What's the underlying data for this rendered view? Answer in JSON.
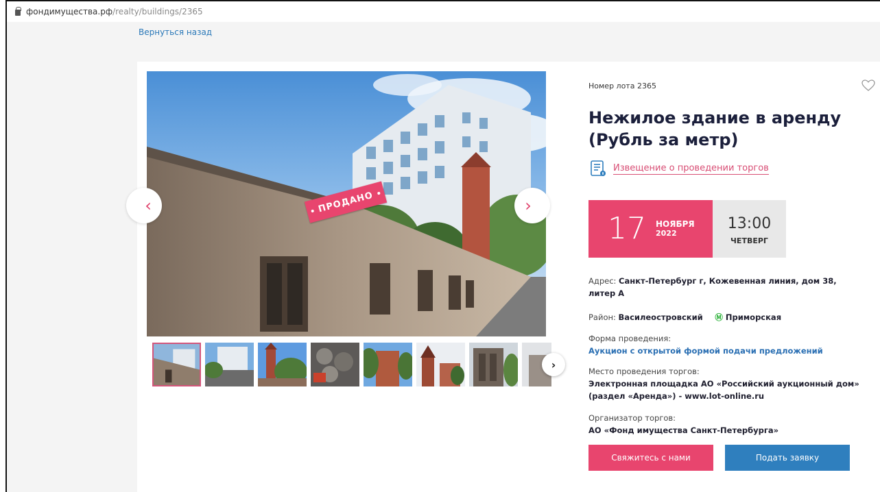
{
  "browser": {
    "url_domain": "фондимущества.рф",
    "url_path": "/realty/buildings/2365"
  },
  "nav": {
    "back_label": "Вернуться назад"
  },
  "gallery": {
    "sold_label": "ПРОДАНО",
    "prev_label": "‹",
    "next_label": "›",
    "thumbs_next_label": "›",
    "thumbnail_count": 8,
    "active_thumbnail": 1
  },
  "lot": {
    "number_label": "Номер лота 2365",
    "title": "Нежилое здание в аренду (Рубль за метр)",
    "notice_link": "Извещение о проведении торгов"
  },
  "auction_date": {
    "day": "17",
    "month": "НОЯБРЯ",
    "year": "2022",
    "time": "13:00",
    "weekday": "ЧЕТВЕРГ"
  },
  "details": {
    "address_label": "Адрес:",
    "address_value": "Санкт-Петербург г, Кожевенная линия, дом 38, литер А",
    "district_label": "Район:",
    "district_value": "Василеостровский",
    "metro_icon": "Ⓜ",
    "metro_value": "Приморская",
    "form_label": "Форма проведения:",
    "form_value": "Аукцион с открытой формой подачи предложений",
    "venue_label": "Место проведения торгов:",
    "venue_value": "Электронная площадка АО «Российский аукционный дом» (раздел «Аренда») - www.lot-online.ru",
    "organizer_label": "Организатор торгов:",
    "organizer_value": "АО «Фонд имущества Санкт-Петербурга»"
  },
  "actions": {
    "contact_label": "Свяжитесь с нами",
    "apply_label": "Подать заявку"
  },
  "colors": {
    "accent_pink": "#e8456e",
    "link_blue": "#2a78b8",
    "apply_blue": "#2f7fbe",
    "metro_green": "#2eb23b"
  }
}
